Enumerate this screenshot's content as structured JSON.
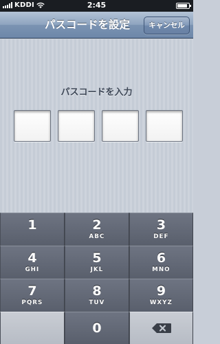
{
  "status_bar": {
    "carrier": "KDDI",
    "time": "2:45",
    "signal_bars": 5,
    "battery_level": 0.9
  },
  "nav": {
    "title": "パスコードを設定",
    "cancel_label": "キャンセル"
  },
  "main": {
    "prompt": "パスコードを入力",
    "code_box_count": 4
  },
  "keypad": {
    "keys": [
      {
        "digit": "1",
        "letters": ""
      },
      {
        "digit": "2",
        "letters": "ABC"
      },
      {
        "digit": "3",
        "letters": "DEF"
      },
      {
        "digit": "4",
        "letters": "GHI"
      },
      {
        "digit": "5",
        "letters": "JKL"
      },
      {
        "digit": "6",
        "letters": "MNO"
      },
      {
        "digit": "7",
        "letters": "PQRS"
      },
      {
        "digit": "8",
        "letters": "TUV"
      },
      {
        "digit": "9",
        "letters": "WXYZ"
      },
      {
        "digit": "0",
        "letters": ""
      }
    ],
    "delete_icon": "backspace-icon"
  },
  "colors": {
    "nav_bar": "#7b93b2",
    "keypad_key": "#626875",
    "blank_key": "#bfc4cc"
  }
}
